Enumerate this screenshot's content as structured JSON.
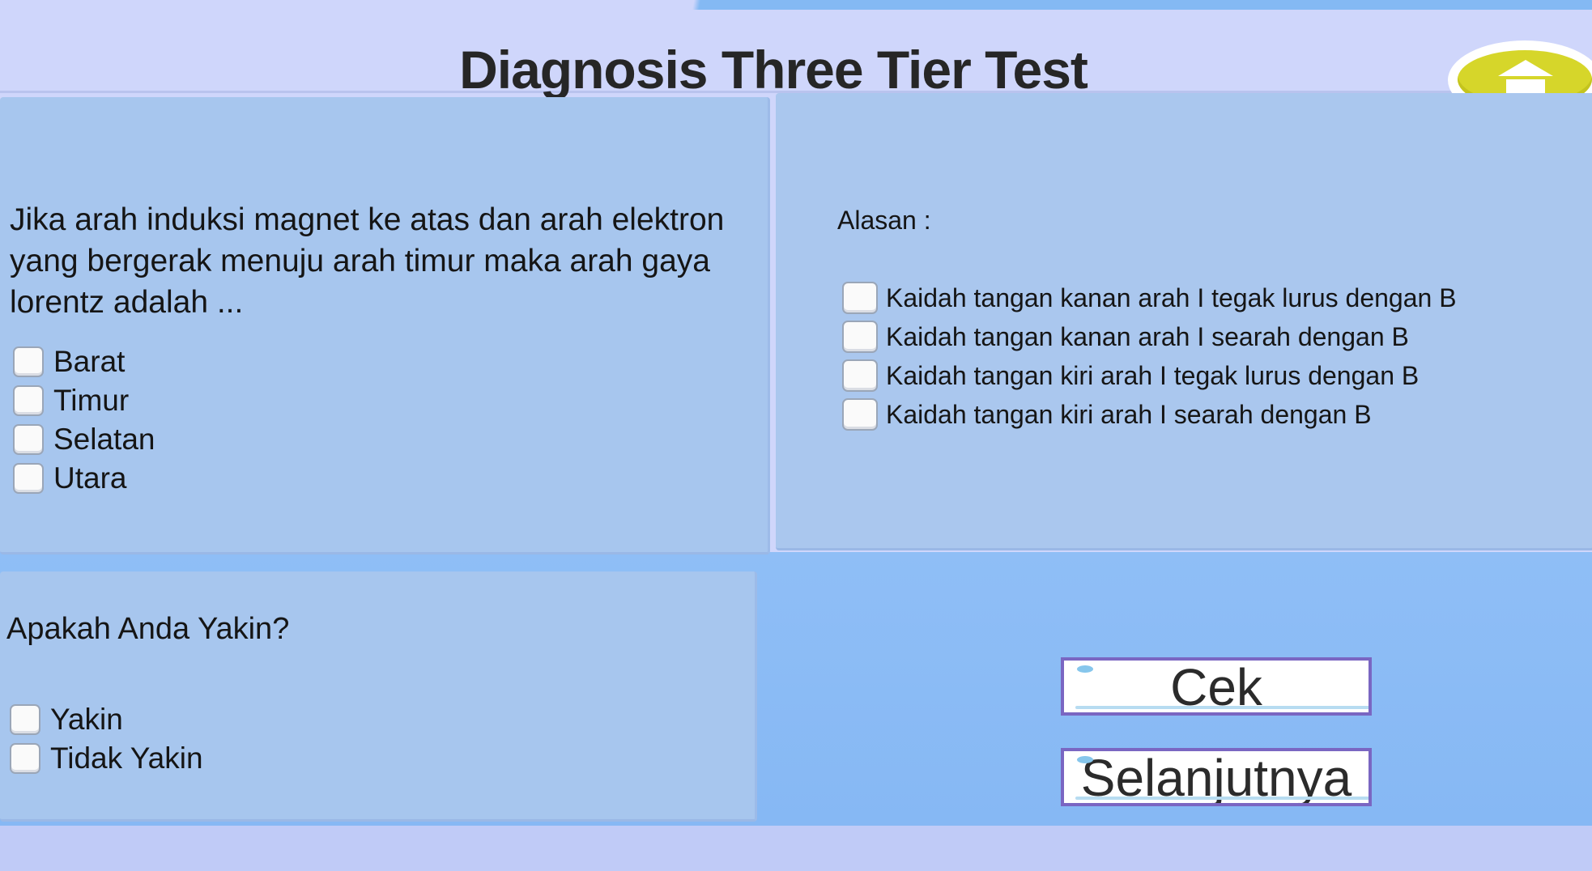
{
  "header": {
    "title": "Diagnosis Three Tier Test",
    "home_button_icon": "home-icon",
    "home_button_color": "#d6d62a"
  },
  "question": {
    "text": "Jika arah induksi magnet ke atas dan arah elektron yang bergerak menuju arah timur maka arah gaya lorentz adalah ...",
    "options": [
      "Barat",
      "Timur",
      "Selatan",
      "Utara"
    ]
  },
  "reason": {
    "label": "Alasan :",
    "options": [
      "Kaidah tangan kanan arah I tegak lurus dengan B",
      "Kaidah tangan kanan arah I searah dengan B",
      "Kaidah tangan kiri arah I tegak lurus dengan B",
      "Kaidah tangan kiri arah I searah dengan B"
    ]
  },
  "confidence": {
    "label": "Apakah Anda Yakin?",
    "options": [
      "Yakin",
      "Tidak Yakin"
    ]
  },
  "buttons": {
    "check_label": "Cek",
    "next_label": "Selanjutnya",
    "border_color": "#7a66c2"
  },
  "colors": {
    "background": "#cfd6fb",
    "panel": "#a7c6ee",
    "accent_blue": "#8fbef6"
  }
}
